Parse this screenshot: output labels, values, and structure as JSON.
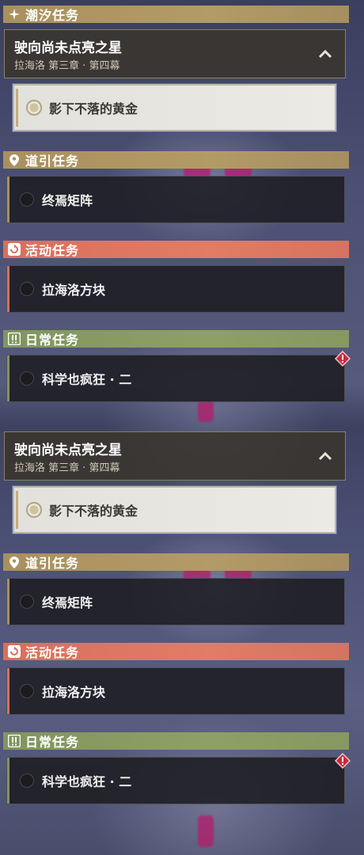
{
  "groups": {
    "tide_header": "潮汐任务",
    "guide_header": "道引任务",
    "event_header": "活动任务",
    "daily_header": "日常任务"
  },
  "main_quest": {
    "title": "驶向尚未点亮之星",
    "subtitle": "拉海洛 第三章 · 第四幕",
    "active_step": "影下不落的黄金"
  },
  "tasks": {
    "guide": "终焉矩阵",
    "event": "拉海洛方块",
    "daily": "科学也疯狂 · 二"
  },
  "colors": {
    "tide": "#a9905e",
    "guide": "#a9905e",
    "event": "#d86f5e",
    "daily": "#80965d",
    "alert": "#c8283c"
  }
}
